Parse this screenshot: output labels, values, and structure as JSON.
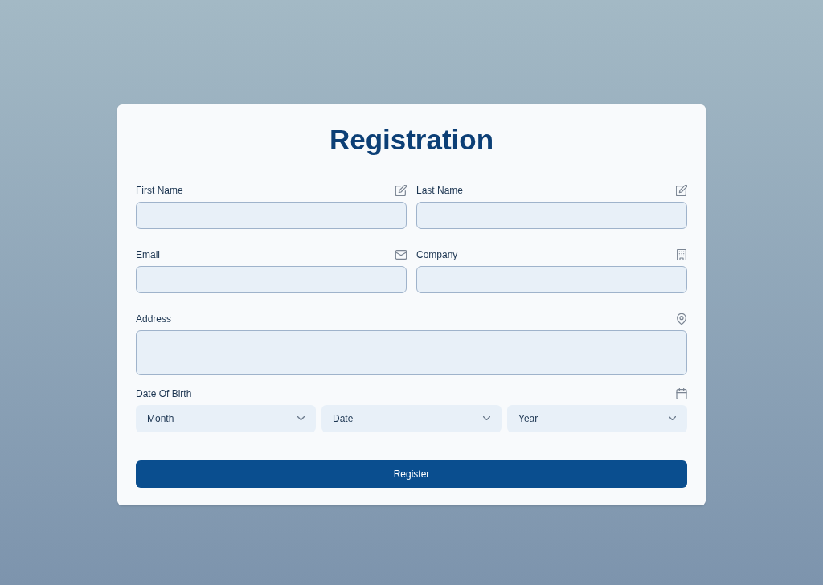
{
  "form": {
    "title": "Registration",
    "fields": [
      {
        "kind": "name",
        "label": "First Name"
      },
      {
        "kind": "name",
        "label": "Last Name"
      },
      {
        "kind": "email",
        "label": "Email"
      },
      {
        "kind": "company",
        "label": "Company"
      },
      {
        "kind": "address",
        "label": "Address"
      },
      {
        "kind": "date",
        "label": "Date Of Birth",
        "selects": [
          "Month",
          "Date",
          "Year"
        ]
      }
    ],
    "submit_button": "Register"
  }
}
